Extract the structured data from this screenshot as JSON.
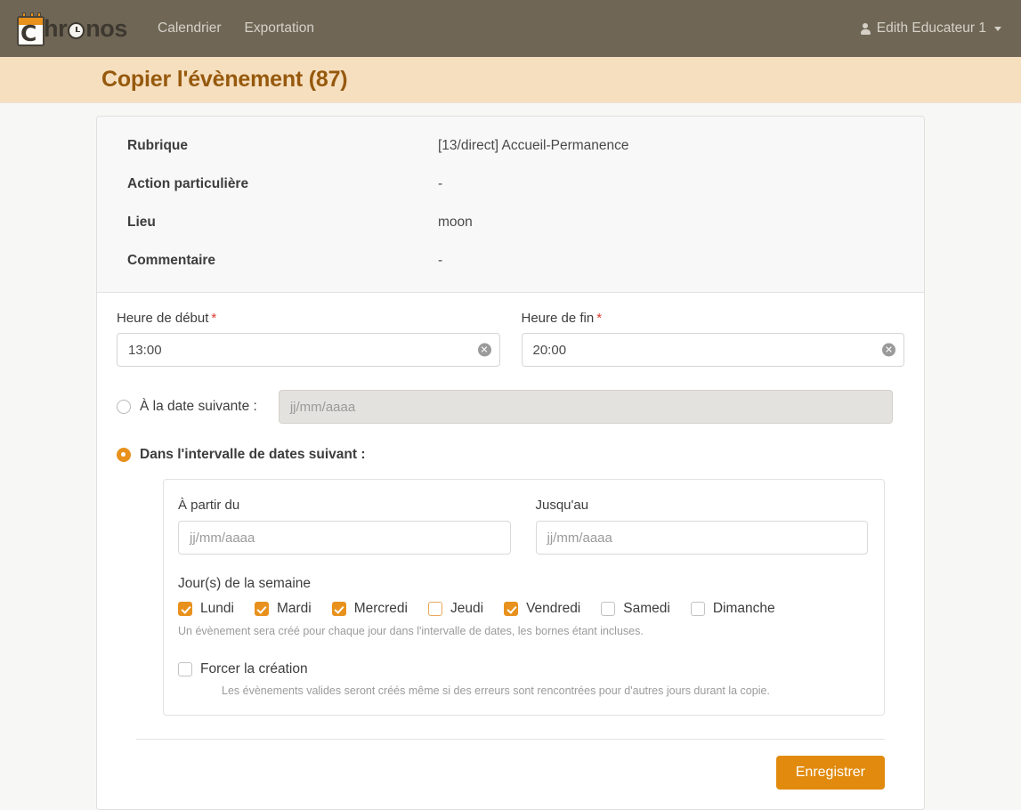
{
  "navbar": {
    "brand_letter": "C",
    "brand_text_pre": "hr",
    "brand_text_post": "nos",
    "links": [
      {
        "label": "Calendrier"
      },
      {
        "label": "Exportation"
      }
    ],
    "user": {
      "name": "Edith Educateur 1",
      "icon": "user-icon",
      "caret_icon": "chevron-down-icon"
    }
  },
  "page_header": {
    "title": "Copier l'évènement (87)"
  },
  "info": {
    "rows": [
      {
        "label": "Rubrique",
        "value": "[13/direct] Accueil-Permanence"
      },
      {
        "label": "Action particulière",
        "value": "-"
      },
      {
        "label": "Lieu",
        "value": "moon"
      },
      {
        "label": "Commentaire",
        "value": "-"
      }
    ]
  },
  "form": {
    "start_time": {
      "label": "Heure de début",
      "required_mark": "*",
      "value": "13:00",
      "clear_icon": "✕"
    },
    "end_time": {
      "label": "Heure de fin",
      "required_mark": "*",
      "value": "20:00",
      "clear_icon": "✕"
    },
    "single_date": {
      "radio_label": "À la date suivante :",
      "selected": false,
      "input_placeholder": "jj/mm/aaaa",
      "input_disabled": true
    },
    "range_date": {
      "radio_label": "Dans l'intervalle de dates suivant :",
      "selected": true,
      "from": {
        "label": "À partir du",
        "placeholder": "jj/mm/aaaa",
        "value": ""
      },
      "to": {
        "label": "Jusqu'au",
        "placeholder": "jj/mm/aaaa",
        "value": ""
      },
      "days_title": "Jour(s) de la semaine",
      "days": [
        {
          "label": "Lundi",
          "checked": true,
          "focused": false
        },
        {
          "label": "Mardi",
          "checked": true,
          "focused": false
        },
        {
          "label": "Mercredi",
          "checked": true,
          "focused": false
        },
        {
          "label": "Jeudi",
          "checked": false,
          "focused": true
        },
        {
          "label": "Vendredi",
          "checked": true,
          "focused": false
        },
        {
          "label": "Samedi",
          "checked": false,
          "focused": false
        },
        {
          "label": "Dimanche",
          "checked": false,
          "focused": false
        }
      ],
      "days_helper": "Un évènement sera créé pour chaque jour dans l'intervalle de dates, les bornes étant incluses.",
      "force": {
        "label": "Forcer la création",
        "checked": false,
        "helper": "Les évènements valides seront créés même si des erreurs sont rencontrées pour d'autres jours durant la copie."
      }
    },
    "save_label": "Enregistrer"
  },
  "colors": {
    "navbar_bg": "#6f6656",
    "header_bg": "#f6dfbf",
    "header_text": "#96590d",
    "accent": "#e8911c",
    "save_button": "#e18a0d",
    "required": "#e03a2f",
    "page_bg": "#f7f7f5"
  }
}
